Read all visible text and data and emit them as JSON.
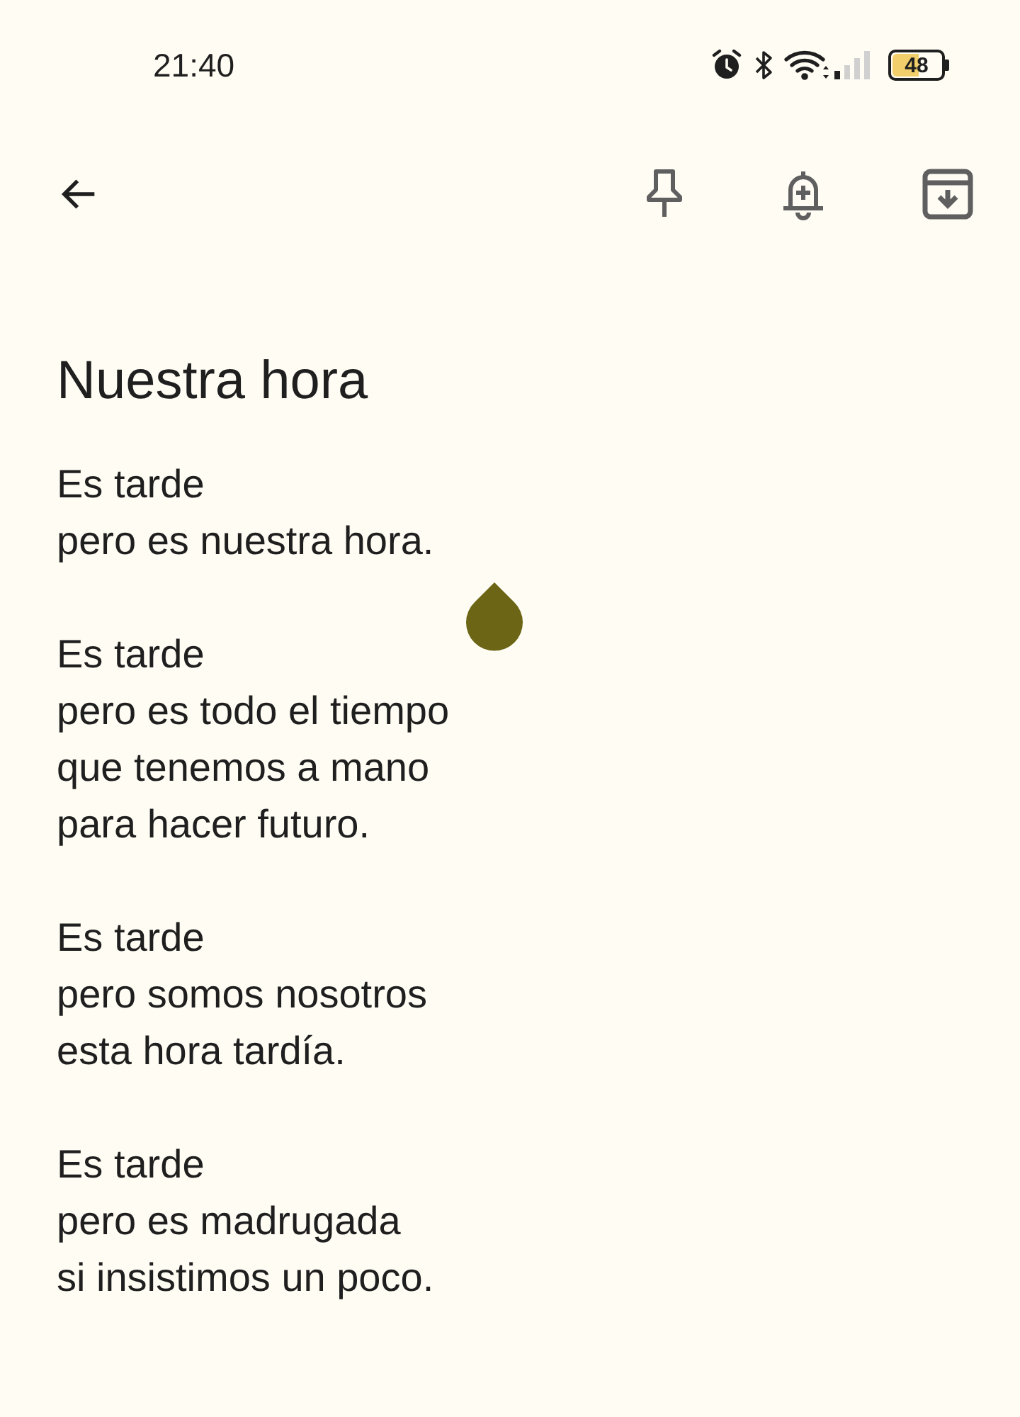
{
  "status_bar": {
    "time": "21:40",
    "battery": "48"
  },
  "note": {
    "title": "Nuestra hora",
    "stanzas": [
      [
        "Es tarde",
        "pero es nuestra hora."
      ],
      [
        "Es tarde",
        "pero es todo el tiempo",
        "que tenemos a mano",
        "para hacer futuro."
      ],
      [
        "Es tarde",
        "pero somos nosotros",
        "esta hora tardía."
      ],
      [
        "Es tarde",
        "pero es madrugada",
        "si insistimos un poco."
      ]
    ]
  }
}
